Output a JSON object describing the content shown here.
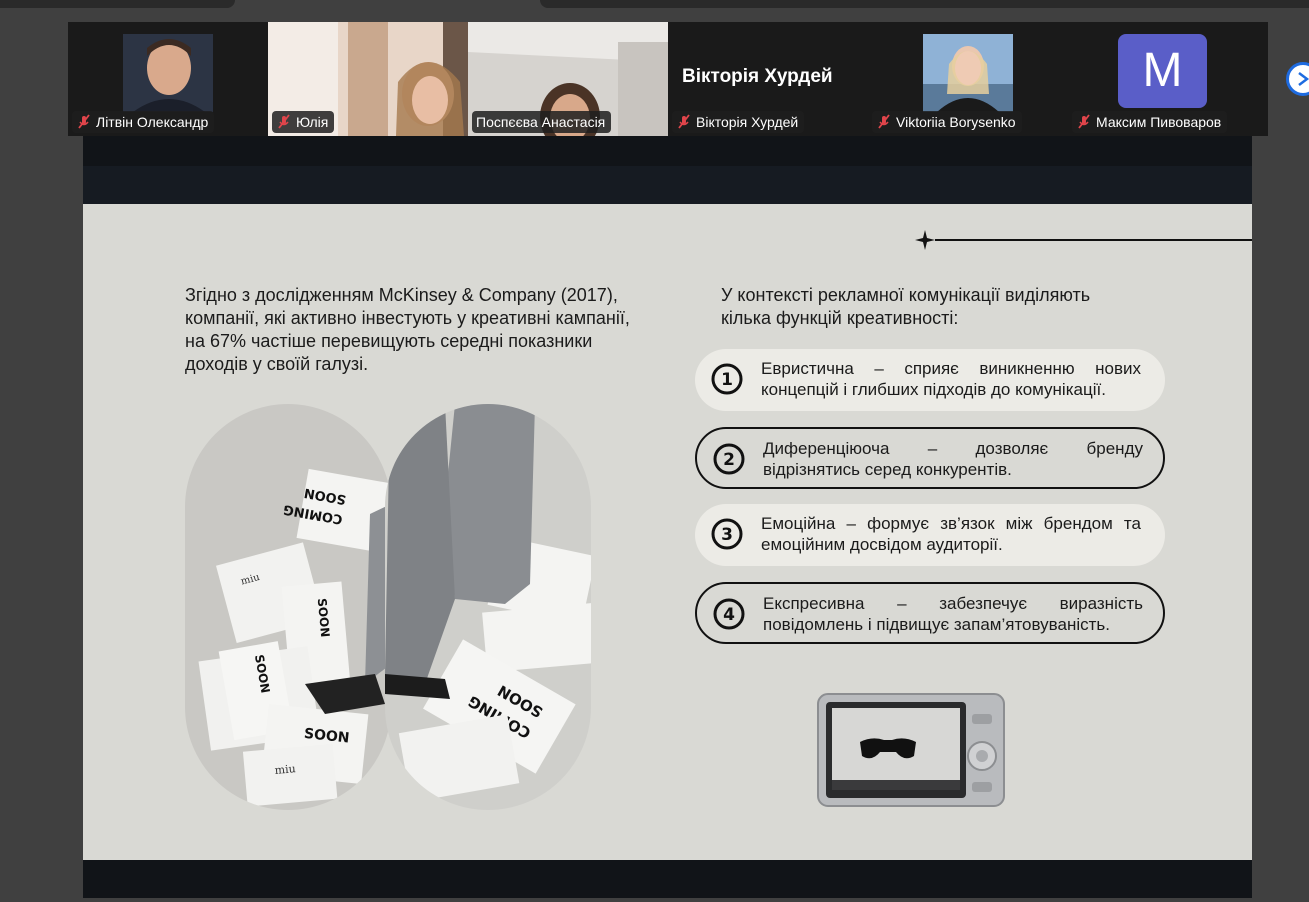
{
  "participants": [
    {
      "name": "Літвін Олександр",
      "active": false
    },
    {
      "name": "Юлія",
      "active": false
    },
    {
      "name": "Поспєєва Анастасія",
      "active": true
    },
    {
      "name": "Вікторія Хурдей",
      "display_title": "Вікторія Хурдей",
      "active": false
    },
    {
      "name": "Viktoriia Borysenko",
      "active": false
    },
    {
      "name": "Максим Пивоваров",
      "avatar_letter": "M",
      "active": false
    }
  ],
  "colors": {
    "active_speaker": "#2ed35a",
    "avatar_bg": "#5a5ec8",
    "muted_mic": "#e0454b",
    "nav_button": "#1e6be0"
  },
  "icons": {
    "muted": "mic-off-icon",
    "next": "chevron-right-icon"
  },
  "slide": {
    "left_paragraph": "Згідно з дослідженням McKinsey & Company (2017), компанії, які активно інвестують у креативні кампанії, на 67% частіше перевищують середні показники доходів у своїй галузі.",
    "right_intro": "У контексті рекламної комунікації виділяють кілька функцій креативності:",
    "functions": [
      {
        "number": "1",
        "text": "Евристична – сприяє виникненню нових концепцій і глибших підходів до комунікації."
      },
      {
        "number": "2",
        "text": "Диференціюоча – дозволяє бренду відрізнятись серед конкурентів."
      },
      {
        "number": "3",
        "text": "Емоційна – формує зв’язок між брендом та емоційним досвідом аудиторії."
      },
      {
        "number": "4",
        "text": "Експресивна – забезпечує виразність повідомлень і підвищує запам’ятовуваність."
      }
    ],
    "photo_papers": [
      "COMING",
      "SOON",
      "miu"
    ]
  }
}
